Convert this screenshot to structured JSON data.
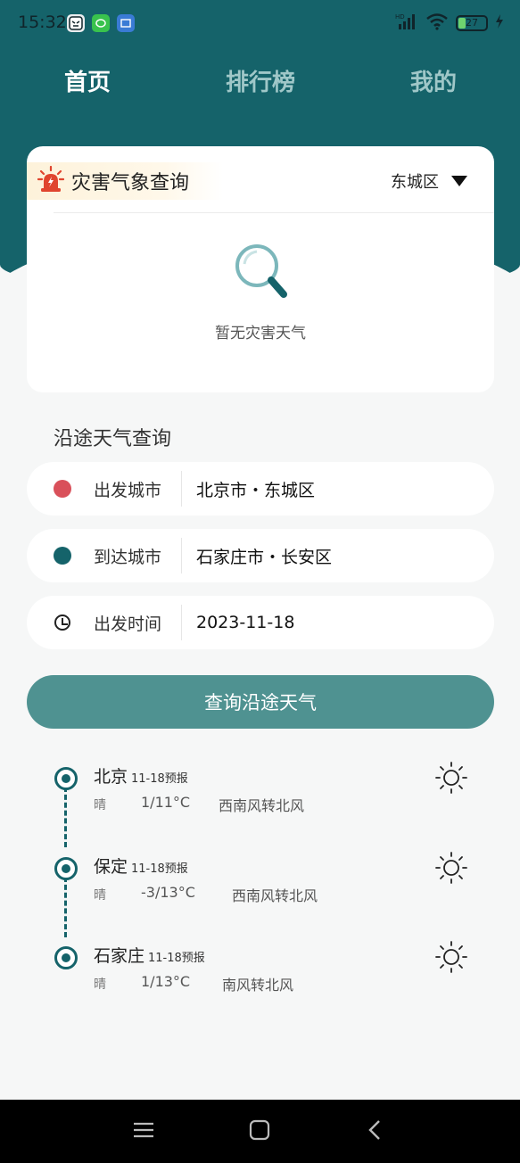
{
  "status_bar": {
    "time": "15:32",
    "battery": "27",
    "network": "HD"
  },
  "tabs": [
    {
      "label": "首页",
      "active": true
    },
    {
      "label": "排行榜",
      "active": false
    },
    {
      "label": "我的",
      "active": false
    }
  ],
  "disaster": {
    "title": "灾害气象查询",
    "district": "东城区",
    "empty_text": "暂无灾害天气"
  },
  "route": {
    "section_title": "沿途天气查询",
    "rows": [
      {
        "label": "出发城市",
        "value": "北京市・东城区",
        "color": "#d9505a"
      },
      {
        "label": "到达城市",
        "value": "石家庄市・长安区",
        "color": "#15636a"
      },
      {
        "label": "出发时间",
        "value": "2023-11-18"
      }
    ],
    "query_button": "查询沿途天气"
  },
  "stops": [
    {
      "city": "北京",
      "date": "11-18预报",
      "weather": "晴",
      "temp": "1/11°C",
      "wind": "西南风转北风",
      "icon": "sun-icon"
    },
    {
      "city": "保定",
      "date": "11-18预报",
      "weather": "晴",
      "temp": "-3/13°C",
      "wind": "西南风转北风",
      "icon": "sun-icon"
    },
    {
      "city": "石家庄",
      "date": "11-18预报",
      "weather": "晴",
      "temp": "1/13°C",
      "wind": "南风转北风",
      "icon": "sun-icon"
    }
  ],
  "colors": {
    "primary": "#15636a",
    "button": "#4f9291",
    "depart_dot": "#d9505a"
  }
}
